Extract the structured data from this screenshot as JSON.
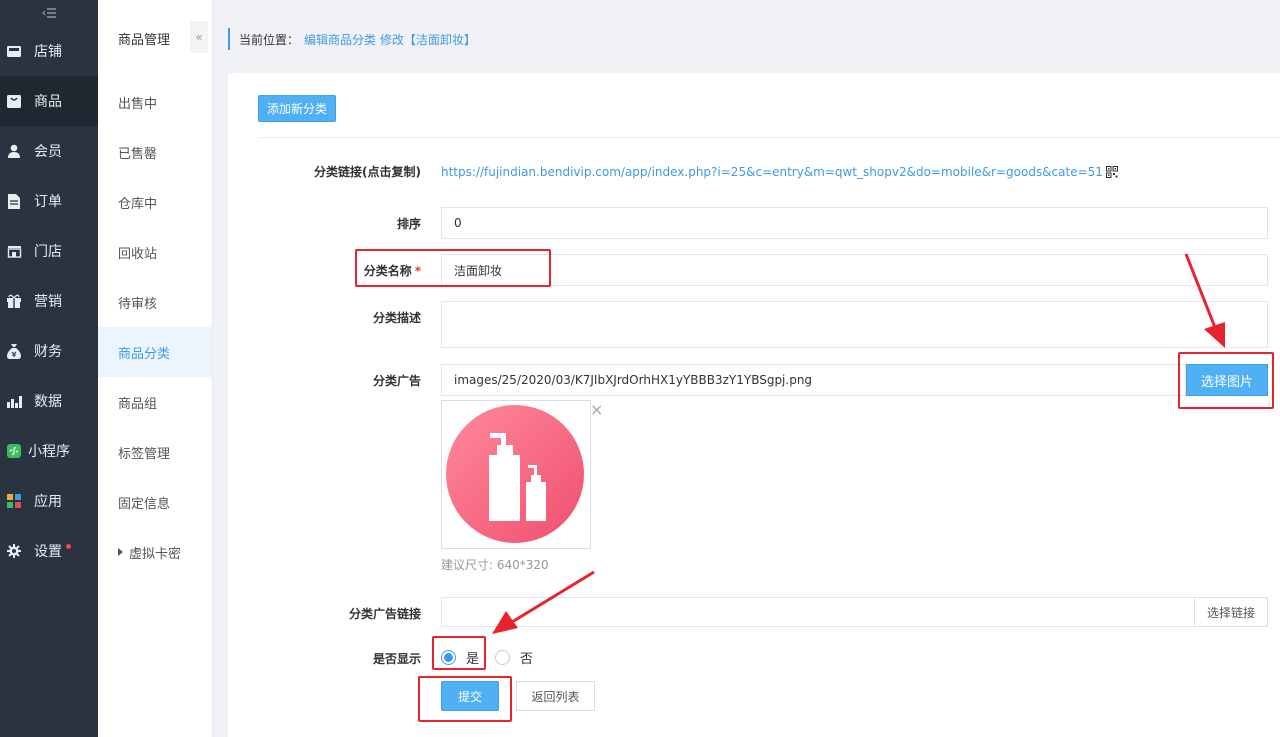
{
  "sidebar": {
    "toggle_icon": "menu-collapse-icon",
    "items": [
      {
        "label": "店铺",
        "icon": "store-icon"
      },
      {
        "label": "商品",
        "icon": "bag-icon"
      },
      {
        "label": "会员",
        "icon": "user-icon"
      },
      {
        "label": "订单",
        "icon": "document-icon"
      },
      {
        "label": "门店",
        "icon": "shop-icon"
      },
      {
        "label": "营销",
        "icon": "gift-icon"
      },
      {
        "label": "财务",
        "icon": "money-bag-icon"
      },
      {
        "label": "数据",
        "icon": "bar-chart-icon"
      },
      {
        "label": "小程序",
        "icon": "miniprogram-icon"
      },
      {
        "label": "应用",
        "icon": "apps-icon"
      },
      {
        "label": "设置",
        "icon": "gear-icon"
      }
    ],
    "active_index": 1
  },
  "submenu": {
    "title": "商品管理",
    "collapse_icon": "double-chevron-left-icon",
    "links": [
      "出售中",
      "已售罄",
      "仓库中",
      "回收站",
      "待审核",
      "商品分类",
      "商品组",
      "标签管理",
      "固定信息",
      "虚拟卡密"
    ],
    "active_index": 5
  },
  "breadcrumb": {
    "label": "当前位置：",
    "path": "编辑商品分类 修改【洁面卸妆】"
  },
  "toolbar": {
    "add_label": "添加新分类"
  },
  "form": {
    "link_label": "分类链接(点击复制)",
    "link_url": "https://fujindian.bendivip.com/app/index.php?i=25&c=entry&m=qwt_shopv2&do=mobile&r=goods&cate=51",
    "sort_label": "排序",
    "sort_value": "0",
    "name_label": "分类名称",
    "name_required": "*",
    "name_value": "洁面卸妆",
    "desc_label": "分类描述",
    "desc_value": "",
    "ad_label": "分类广告",
    "ad_value": "images/25/2020/03/K7JIbXJrdOrhHX1yYBBB3zY1YBSgpj.png",
    "choose_image_label": "选择图片",
    "thumb_close": "×",
    "size_hint": "建议尺寸: 640*320",
    "ad_link_label": "分类广告链接",
    "ad_link_value": "",
    "choose_link_label": "选择链接",
    "show_label": "是否显示",
    "show_yes": "是",
    "show_no": "否",
    "show_value": "是",
    "submit_label": "提交",
    "back_label": "返回列表"
  },
  "colors": {
    "sidebar_bg": "#2a3440",
    "accent": "#3d9ae8",
    "button_blue": "#4fb0f4",
    "annotation_red": "#e7242d",
    "thumbnail_circle": "#f7617e"
  }
}
